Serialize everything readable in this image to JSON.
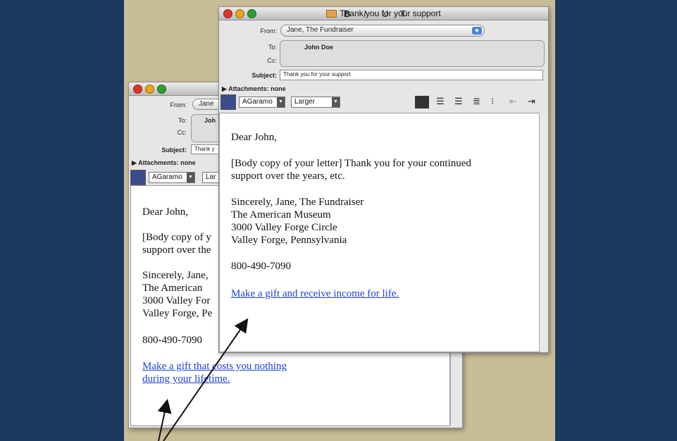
{
  "back_window": {
    "from_label": "From:",
    "from_value": "Jane",
    "to_label": "To:",
    "to_value": "Joh",
    "cc_label": "Cc:",
    "subject_label": "Subject:",
    "subject_value": "Thank y",
    "attachments_label": "Attachments:",
    "attachments_value": "none",
    "font_name": "AGaramo",
    "font_size": "Lar",
    "body": {
      "greeting": "Dear John,",
      "para1_line1": "[Body copy of y",
      "para1_line2": "support over the",
      "sig1": "Sincerely, Jane,",
      "sig2": "The American",
      "sig3": "3000 Valley For",
      "sig4": "Valley Forge, Pe",
      "phone": "800-490-7090",
      "link_line1": "Make a gift that costs you nothing",
      "link_line2": "during your lifetime."
    }
  },
  "front_window": {
    "title": "Thank you for your support",
    "from_label": "From:",
    "from_value": "Jane, The Fundraiser",
    "to_label": "To:",
    "to_value": "John Doe",
    "cc_label": "Cc:",
    "subject_label": "Subject:",
    "subject_value": "Thank you for your support",
    "attachments_label": "Attachments:",
    "attachments_value": "none",
    "font_name": "AGaramo",
    "font_size": "Larger",
    "format_buttons": [
      "B",
      "I",
      "U",
      "T"
    ],
    "body": {
      "greeting": "Dear John,",
      "para1_line1": "[Body copy of your letter]  Thank you for your continued",
      "para1_line2": "support over the years, etc.",
      "sig1": "Sincerely, Jane, The Fundraiser",
      "sig2": "The American Museum",
      "sig3": "3000 Valley Forge Circle",
      "sig4": "Valley Forge, Pennsylvania",
      "phone": "800-490-7090",
      "link": "Make a gift and receive income for life."
    }
  },
  "colors": {
    "outer_background": "#1b3a5e",
    "stage_background": "#c9bd98",
    "link": "#1d3fd3"
  },
  "icons": [
    "close-light",
    "minimize-light",
    "zoom-light",
    "envelope-icon",
    "arrow-annotation"
  ]
}
